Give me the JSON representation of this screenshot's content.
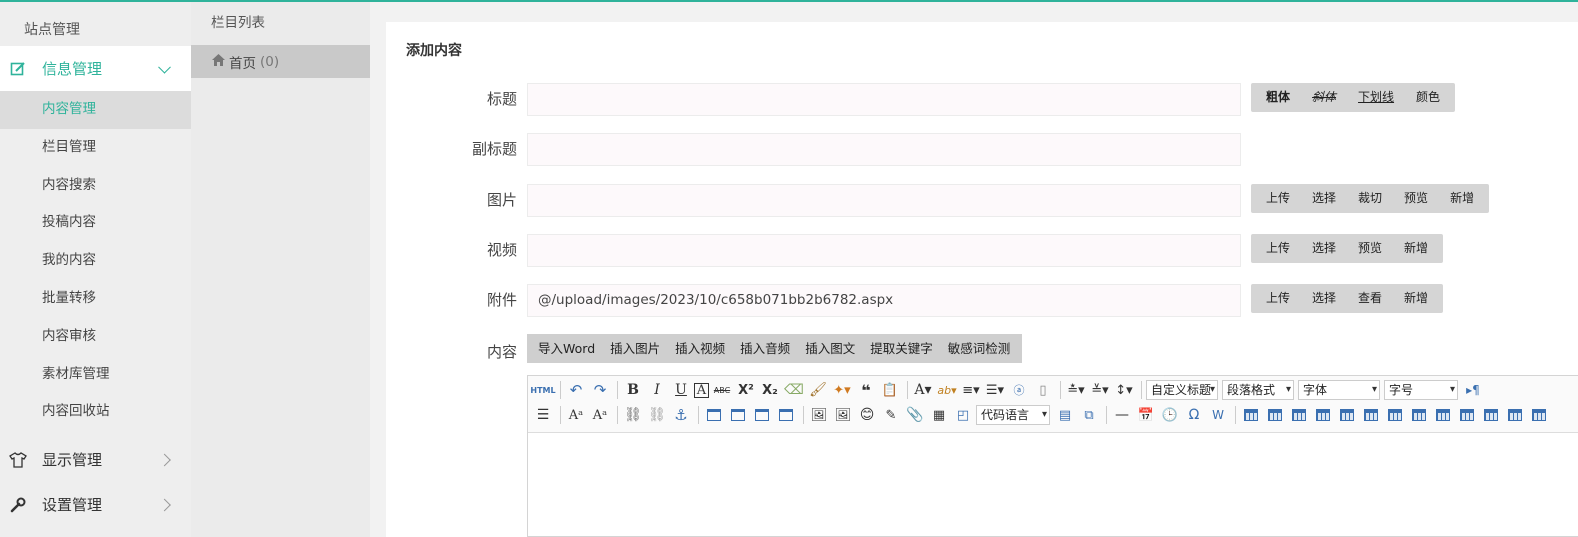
{
  "colors": {
    "accent": "#2fb39b",
    "sidebar_bg": "#eeeeee",
    "active_item_bg": "#dcdcdc"
  },
  "sidebar": {
    "title": "站点管理",
    "groups": [
      {
        "label": "信息管理",
        "icon": "edit-icon",
        "expanded": true
      },
      {
        "label": "显示管理",
        "icon": "shirt-icon",
        "expanded": false
      },
      {
        "label": "设置管理",
        "icon": "wrench-icon",
        "expanded": false
      }
    ],
    "items": [
      "内容管理",
      "栏目管理",
      "内容搜索",
      "投稿内容",
      "我的内容",
      "批量转移",
      "内容审核",
      "素材库管理",
      "内容回收站"
    ],
    "active_item": "内容管理"
  },
  "column_panel": {
    "title": "栏目列表",
    "item_label": "首页",
    "item_count": "(0)"
  },
  "form": {
    "title": "添加内容",
    "fields": {
      "title_label": "标题",
      "subtitle_label": "副标题",
      "image_label": "图片",
      "video_label": "视频",
      "attachment_label": "附件",
      "attachment_value": "@/upload/images/2023/10/c658b071bb2b6782.aspx",
      "content_label": "内容"
    },
    "title_buttons": [
      "粗体",
      "斜体",
      "下划线",
      "颜色"
    ],
    "image_buttons": [
      "上传",
      "选择",
      "裁切",
      "预览",
      "新增"
    ],
    "video_buttons": [
      "上传",
      "选择",
      "预览",
      "新增"
    ],
    "attachment_buttons": [
      "上传",
      "选择",
      "查看",
      "新增"
    ],
    "content_buttons": [
      "导入Word",
      "插入图片",
      "插入视频",
      "插入音频",
      "插入图文",
      "提取关键字",
      "敏感词检测"
    ]
  },
  "editor": {
    "html_label": "HTML",
    "dropdowns": {
      "custom_title": "自定义标题",
      "paragraph": "段落格式",
      "font": "字体",
      "font_size": "字号",
      "code_language": "代码语言"
    }
  }
}
